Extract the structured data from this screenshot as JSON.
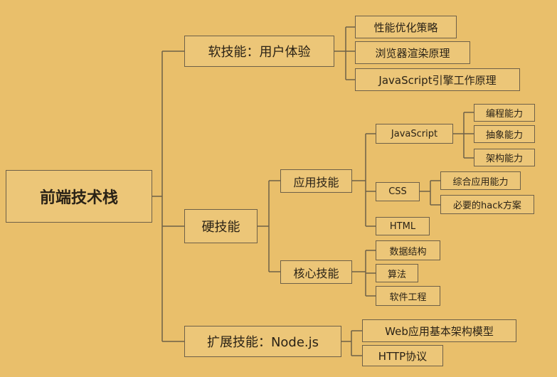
{
  "root": "前端技术栈",
  "soft": {
    "label": "软技能：用户体验",
    "children": [
      "性能优化策略",
      "浏览器渲染原理",
      "JavaScript引擎工作原理"
    ]
  },
  "hard": {
    "label": "硬技能",
    "app": {
      "label": "应用技能",
      "javascript": {
        "label": "JavaScript",
        "children": [
          "编程能力",
          "抽象能力",
          "架构能力"
        ]
      },
      "css": {
        "label": "CSS",
        "children": [
          "综合应用能力",
          "必要的hack方案"
        ]
      },
      "html": {
        "label": "HTML"
      }
    },
    "core": {
      "label": "核心技能",
      "children": [
        "数据结构",
        "算法",
        "软件工程"
      ]
    }
  },
  "ext": {
    "label": "扩展技能：Node.js",
    "children": [
      "Web应用基本架构模型",
      "HTTP协议"
    ]
  }
}
